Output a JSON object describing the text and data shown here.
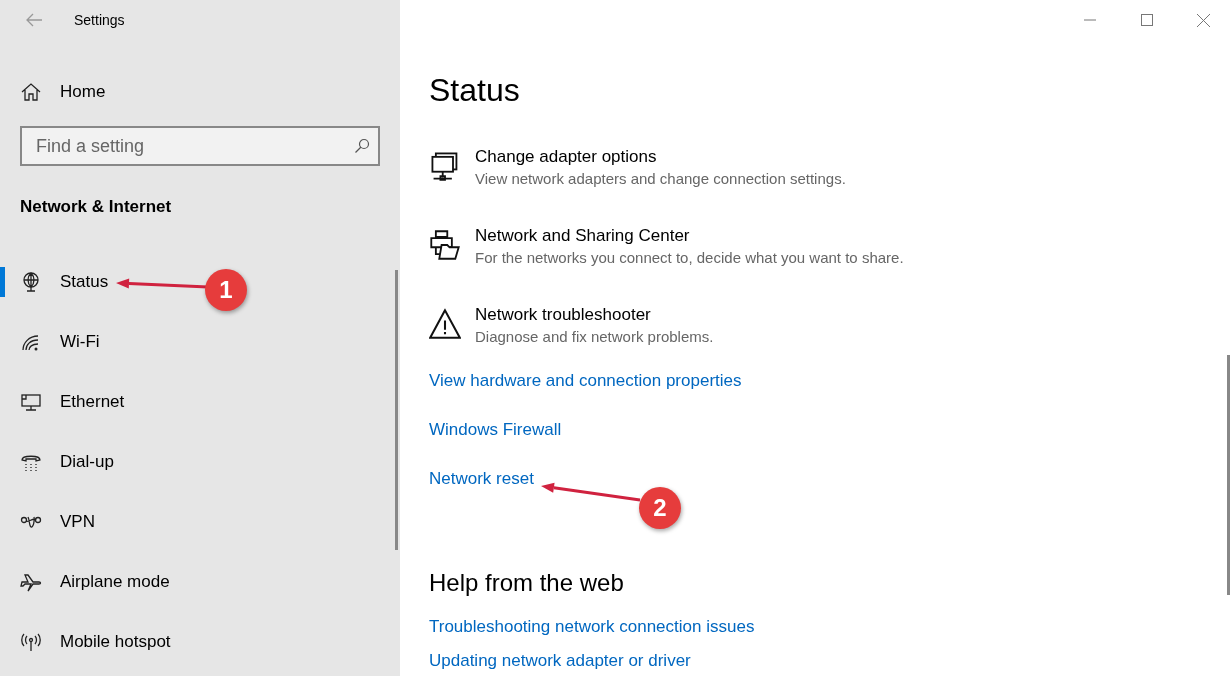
{
  "window": {
    "title": "Settings"
  },
  "sidebar": {
    "home": "Home",
    "search": {
      "placeholder": "Find a setting"
    },
    "section": "Network & Internet",
    "items": [
      {
        "label": "Status",
        "selected": true
      },
      {
        "label": "Wi-Fi",
        "selected": false
      },
      {
        "label": "Ethernet",
        "selected": false
      },
      {
        "label": "Dial-up",
        "selected": false
      },
      {
        "label": "VPN",
        "selected": false
      },
      {
        "label": "Airplane mode",
        "selected": false
      },
      {
        "label": "Mobile hotspot",
        "selected": false
      }
    ]
  },
  "main": {
    "heading": "Status",
    "items": [
      {
        "title": "Change adapter options",
        "description": "View network adapters and change connection settings."
      },
      {
        "title": "Network and Sharing Center",
        "description": "For the networks you connect to, decide what you want to share."
      },
      {
        "title": "Network troubleshooter",
        "description": "Diagnose and fix network problems."
      }
    ],
    "links": [
      "View hardware and connection properties",
      "Windows Firewall",
      "Network reset"
    ],
    "help_heading": "Help from the web",
    "help_links": [
      "Troubleshooting network connection issues",
      "Updating network adapter or driver"
    ]
  },
  "callouts": [
    {
      "number": "1"
    },
    {
      "number": "2"
    }
  ]
}
